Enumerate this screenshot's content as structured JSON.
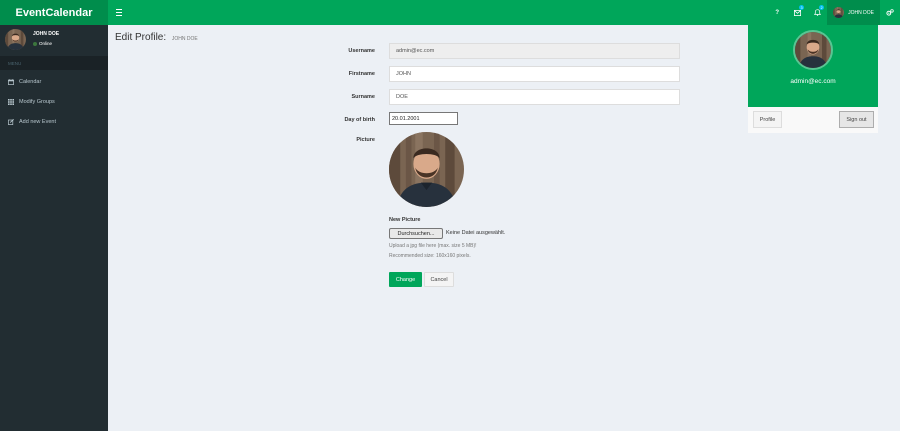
{
  "app": {
    "title": "EventCalendar"
  },
  "header": {
    "help_label": "?",
    "mail_badge": "3",
    "bell_badge": "2",
    "user_name": "JOHN DOE"
  },
  "sidebar": {
    "user_name": "JOHN DOE",
    "user_status": "Online",
    "menu_header": "MENU",
    "items": [
      {
        "label": "Calendar",
        "icon": "calendar-icon"
      },
      {
        "label": "Modify Groups",
        "icon": "grid-icon"
      },
      {
        "label": "Add new Event",
        "icon": "edit-icon"
      }
    ]
  },
  "page": {
    "title": "Edit Profile:",
    "subtitle": "JOHN DOE"
  },
  "form": {
    "username_label": "Username",
    "username_value": "admin@ec.com",
    "firstname_label": "Firstname",
    "firstname_value": "JOHN",
    "surname_label": "Surname",
    "surname_value": "DOE",
    "dob_label": "Day of birth",
    "dob_value": "20.01.2001",
    "picture_label": "Picture",
    "new_picture_label": "New Picture",
    "file_button": "Durchsuchen...",
    "file_none": "Keine Datei ausgewählt.",
    "help_line1": "Upload a jpg file here (max. size 5 MB)!",
    "help_line2": "Recommended size: 160x160 pixels.",
    "change_button": "Change",
    "cancel_button": "Cancel"
  },
  "dropdown": {
    "email": "admin@ec.com",
    "profile_button": "Profile",
    "signout_button": "Sign out"
  },
  "colors": {
    "brand": "#00a65a",
    "brand_dark": "#008d4c",
    "sidebar": "#222d32",
    "badge": "#00c0ef"
  }
}
